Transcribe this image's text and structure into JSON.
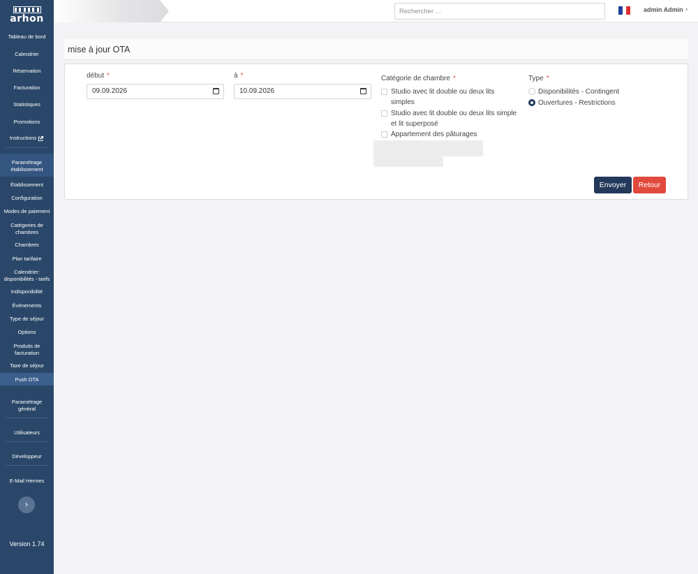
{
  "sidebar": {
    "logo_text": "arhon",
    "items": [
      {
        "label": "Tableau de bord"
      },
      {
        "label": "Calendrier"
      },
      {
        "label": "Réservation"
      },
      {
        "label": "Facturation"
      },
      {
        "label": "Statistiques"
      },
      {
        "label": "Promotions"
      },
      {
        "label": "Instructions"
      }
    ],
    "section_title": "Paramétrage établissement",
    "section_items": [
      {
        "label": "Établissement"
      },
      {
        "label": "Configuration"
      },
      {
        "label": "Modes de paiement"
      },
      {
        "label": "Catégories de chambres"
      },
      {
        "label": "Chambres"
      },
      {
        "label": "Plan tarifaire"
      },
      {
        "label": "Calendrier: disponibilités - tarifs"
      },
      {
        "label": "Indisponibilité"
      },
      {
        "label": "Événements"
      },
      {
        "label": "Type de séjour"
      },
      {
        "label": "Options"
      },
      {
        "label": "Produits de facturation"
      },
      {
        "label": "Taxe de séjour"
      },
      {
        "label": "Push OTA"
      }
    ],
    "bottom_items": [
      {
        "label": "Paramétrage général"
      },
      {
        "label": "Utilisateurs"
      },
      {
        "label": "Développeur"
      },
      {
        "label": "E-Mail Hermes"
      }
    ],
    "expand_icon": "chevron-right-icon",
    "version": "Version 1.74"
  },
  "topbar": {
    "search_placeholder": "Rechercher ...",
    "user_name": "admin Admin",
    "flag_colors": [
      "#1f3f9a",
      "#ffffff",
      "#e0312f"
    ]
  },
  "page": {
    "title": "mise à jour OTA"
  },
  "form": {
    "start_label": "début",
    "start_value": "09.09.2026",
    "end_label": "à",
    "end_value": "10.09.2026",
    "required_mark": "*",
    "category_label": "Catégorie de chambre",
    "categories": [
      {
        "line1": "Studio avec lit double ou deux lits",
        "line2": "simples",
        "checked": false
      },
      {
        "line1": "Studio avec lit double ou deux lits simple",
        "line2": "et lit superposé",
        "checked": false
      },
      {
        "line1": "Appartement des pâturages",
        "line2": "",
        "checked": false
      }
    ],
    "type_label": "Type",
    "types": [
      {
        "label": "Disponibilités - Contingent",
        "selected": false
      },
      {
        "label": "Ouvertures - Restrictions",
        "selected": true
      }
    ],
    "submit_label": "Envoyer",
    "back_label": "Retour"
  },
  "colors": {
    "sidebar_bg": "#2a4769",
    "primary": "#23395b",
    "danger": "#e04a3c",
    "required": "#e05050"
  }
}
